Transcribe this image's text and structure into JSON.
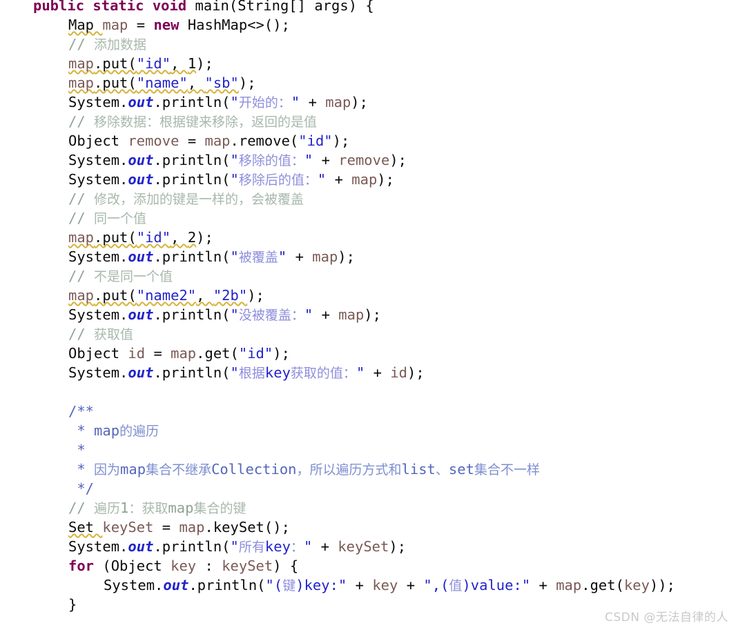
{
  "editor": {
    "language": "java",
    "colors": {
      "keyword": "#7f0055",
      "string": "#2222cc",
      "string_cjk": "#8e8ede",
      "comment": "#8fa396",
      "javadoc": "#5566bb",
      "local_variable": "#7a5a55",
      "static_field": "#2222cc",
      "plain": "#0b0b0b",
      "warning_underline": "#d6b33c",
      "background": "#ffffff"
    },
    "lines": [
      {
        "indent": 1,
        "segments": [
          {
            "t": "public ",
            "c": "kw"
          },
          {
            "t": "static ",
            "c": "kw"
          },
          {
            "t": "void ",
            "c": "kw"
          },
          {
            "t": "main(String[] args) {",
            "c": "plain"
          }
        ]
      },
      {
        "indent": 2,
        "segments": [
          {
            "t": "Map ",
            "c": "plain",
            "wavy": true
          },
          {
            "t": "map ",
            "c": "var"
          },
          {
            "t": "= ",
            "c": "plain"
          },
          {
            "t": "new ",
            "c": "kw"
          },
          {
            "t": "HashMap<>();",
            "c": "plain"
          }
        ]
      },
      {
        "indent": 2,
        "segments": [
          {
            "t": "// ",
            "c": "cmt"
          },
          {
            "t": "添加数据",
            "c": "cmt-cjk",
            "cjk": true
          }
        ]
      },
      {
        "indent": 2,
        "segments": [
          {
            "t": "map",
            "c": "var",
            "wavy": true
          },
          {
            "t": ".put(",
            "c": "plain",
            "wavy": true
          },
          {
            "t": "\"id\"",
            "c": "str",
            "wavy": true
          },
          {
            "t": ", ",
            "c": "plain",
            "wavy": true
          },
          {
            "t": "1",
            "c": "num",
            "wavy": true
          },
          {
            "t": ");",
            "c": "plain"
          }
        ]
      },
      {
        "indent": 2,
        "segments": [
          {
            "t": "map",
            "c": "var",
            "wavy": true
          },
          {
            "t": ".put(",
            "c": "plain",
            "wavy": true
          },
          {
            "t": "\"name\"",
            "c": "str",
            "wavy": true
          },
          {
            "t": ", ",
            "c": "plain",
            "wavy": true
          },
          {
            "t": "\"sb\"",
            "c": "str",
            "wavy": true
          },
          {
            "t": ");",
            "c": "plain"
          }
        ]
      },
      {
        "indent": 2,
        "segments": [
          {
            "t": "System.",
            "c": "plain"
          },
          {
            "t": "out",
            "c": "fld"
          },
          {
            "t": ".println(",
            "c": "plain"
          },
          {
            "t": "\"",
            "c": "str"
          },
          {
            "t": "开始的：",
            "c": "str-cjk",
            "cjk": true
          },
          {
            "t": "\" ",
            "c": "str"
          },
          {
            "t": "+ ",
            "c": "plain"
          },
          {
            "t": "map",
            "c": "var"
          },
          {
            "t": ");",
            "c": "plain"
          }
        ]
      },
      {
        "indent": 2,
        "segments": [
          {
            "t": "// ",
            "c": "cmt"
          },
          {
            "t": "移除数据：根据键来移除，返回的是值",
            "c": "cmt-cjk",
            "cjk": true
          }
        ]
      },
      {
        "indent": 2,
        "segments": [
          {
            "t": "Object ",
            "c": "plain"
          },
          {
            "t": "remove ",
            "c": "var"
          },
          {
            "t": "= ",
            "c": "plain"
          },
          {
            "t": "map",
            "c": "var"
          },
          {
            "t": ".remove(",
            "c": "plain"
          },
          {
            "t": "\"id\"",
            "c": "str"
          },
          {
            "t": ");",
            "c": "plain"
          }
        ]
      },
      {
        "indent": 2,
        "segments": [
          {
            "t": "System.",
            "c": "plain"
          },
          {
            "t": "out",
            "c": "fld"
          },
          {
            "t": ".println(",
            "c": "plain"
          },
          {
            "t": "\"",
            "c": "str"
          },
          {
            "t": "移除的值：",
            "c": "str-cjk",
            "cjk": true
          },
          {
            "t": "\" ",
            "c": "str"
          },
          {
            "t": "+ ",
            "c": "plain"
          },
          {
            "t": "remove",
            "c": "var"
          },
          {
            "t": ");",
            "c": "plain"
          }
        ]
      },
      {
        "indent": 2,
        "segments": [
          {
            "t": "System.",
            "c": "plain"
          },
          {
            "t": "out",
            "c": "fld"
          },
          {
            "t": ".println(",
            "c": "plain"
          },
          {
            "t": "\"",
            "c": "str"
          },
          {
            "t": "移除后的值：",
            "c": "str-cjk",
            "cjk": true
          },
          {
            "t": "\" ",
            "c": "str"
          },
          {
            "t": "+ ",
            "c": "plain"
          },
          {
            "t": "map",
            "c": "var"
          },
          {
            "t": ");",
            "c": "plain"
          }
        ]
      },
      {
        "indent": 2,
        "segments": [
          {
            "t": "// ",
            "c": "cmt"
          },
          {
            "t": "修改，添加的键是一样的，会被覆盖",
            "c": "cmt-cjk",
            "cjk": true
          }
        ]
      },
      {
        "indent": 2,
        "segments": [
          {
            "t": "// ",
            "c": "cmt"
          },
          {
            "t": "同一个值",
            "c": "cmt-cjk",
            "cjk": true
          }
        ]
      },
      {
        "indent": 2,
        "segments": [
          {
            "t": "map",
            "c": "var",
            "wavy": true
          },
          {
            "t": ".put(",
            "c": "plain",
            "wavy": true
          },
          {
            "t": "\"id\"",
            "c": "str",
            "wavy": true
          },
          {
            "t": ", ",
            "c": "plain",
            "wavy": true
          },
          {
            "t": "2",
            "c": "num",
            "wavy": true
          },
          {
            "t": ");",
            "c": "plain"
          }
        ]
      },
      {
        "indent": 2,
        "segments": [
          {
            "t": "System.",
            "c": "plain"
          },
          {
            "t": "out",
            "c": "fld"
          },
          {
            "t": ".println(",
            "c": "plain"
          },
          {
            "t": "\"",
            "c": "str"
          },
          {
            "t": "被覆盖",
            "c": "str-cjk",
            "cjk": true
          },
          {
            "t": "\" ",
            "c": "str"
          },
          {
            "t": "+ ",
            "c": "plain"
          },
          {
            "t": "map",
            "c": "var"
          },
          {
            "t": ");",
            "c": "plain"
          }
        ]
      },
      {
        "indent": 2,
        "segments": [
          {
            "t": "// ",
            "c": "cmt"
          },
          {
            "t": "不是同一个值",
            "c": "cmt-cjk",
            "cjk": true
          }
        ]
      },
      {
        "indent": 2,
        "segments": [
          {
            "t": "map",
            "c": "var",
            "wavy": true
          },
          {
            "t": ".put(",
            "c": "plain",
            "wavy": true
          },
          {
            "t": "\"name2\"",
            "c": "str",
            "wavy": true
          },
          {
            "t": ", ",
            "c": "plain",
            "wavy": true
          },
          {
            "t": "\"2b\"",
            "c": "str",
            "wavy": true
          },
          {
            "t": ");",
            "c": "plain"
          }
        ]
      },
      {
        "indent": 2,
        "segments": [
          {
            "t": "System.",
            "c": "plain"
          },
          {
            "t": "out",
            "c": "fld"
          },
          {
            "t": ".println(",
            "c": "plain"
          },
          {
            "t": "\"",
            "c": "str"
          },
          {
            "t": "没被覆盖：",
            "c": "str-cjk",
            "cjk": true
          },
          {
            "t": "\" ",
            "c": "str"
          },
          {
            "t": "+ ",
            "c": "plain"
          },
          {
            "t": "map",
            "c": "var"
          },
          {
            "t": ");",
            "c": "plain"
          }
        ]
      },
      {
        "indent": 2,
        "segments": [
          {
            "t": "// ",
            "c": "cmt"
          },
          {
            "t": "获取值",
            "c": "cmt-cjk",
            "cjk": true
          }
        ]
      },
      {
        "indent": 2,
        "segments": [
          {
            "t": "Object ",
            "c": "plain"
          },
          {
            "t": "id ",
            "c": "var"
          },
          {
            "t": "= ",
            "c": "plain"
          },
          {
            "t": "map",
            "c": "var"
          },
          {
            "t": ".get(",
            "c": "plain"
          },
          {
            "t": "\"id\"",
            "c": "str"
          },
          {
            "t": ");",
            "c": "plain"
          }
        ]
      },
      {
        "indent": 2,
        "segments": [
          {
            "t": "System.",
            "c": "plain"
          },
          {
            "t": "out",
            "c": "fld"
          },
          {
            "t": ".println(",
            "c": "plain"
          },
          {
            "t": "\"",
            "c": "str"
          },
          {
            "t": "根据",
            "c": "str-cjk",
            "cjk": true
          },
          {
            "t": "key",
            "c": "str"
          },
          {
            "t": "获取的值：",
            "c": "str-cjk",
            "cjk": true
          },
          {
            "t": "\" ",
            "c": "str"
          },
          {
            "t": "+ ",
            "c": "plain"
          },
          {
            "t": "id",
            "c": "var"
          },
          {
            "t": ");",
            "c": "plain"
          }
        ]
      },
      {
        "blank": true
      },
      {
        "indent": 2,
        "segments": [
          {
            "t": "/**",
            "c": "doc"
          }
        ]
      },
      {
        "indent": 2,
        "segments": [
          {
            "t": " * ",
            "c": "doc"
          },
          {
            "t": "map",
            "c": "doc"
          },
          {
            "t": "的遍历",
            "c": "doc-cjk",
            "cjk": true
          }
        ]
      },
      {
        "indent": 2,
        "segments": [
          {
            "t": " *",
            "c": "doc"
          }
        ]
      },
      {
        "indent": 2,
        "segments": [
          {
            "t": " * ",
            "c": "doc"
          },
          {
            "t": "因为",
            "c": "doc-cjk",
            "cjk": true
          },
          {
            "t": "map",
            "c": "doc"
          },
          {
            "t": "集合不继承",
            "c": "doc-cjk",
            "cjk": true
          },
          {
            "t": "Collection",
            "c": "doc"
          },
          {
            "t": "，所以遍历方式和",
            "c": "doc-cjk",
            "cjk": true
          },
          {
            "t": "list",
            "c": "doc"
          },
          {
            "t": "、",
            "c": "doc-cjk",
            "cjk": true
          },
          {
            "t": "set",
            "c": "doc"
          },
          {
            "t": "集合不一样",
            "c": "doc-cjk",
            "cjk": true
          }
        ]
      },
      {
        "indent": 2,
        "segments": [
          {
            "t": " */",
            "c": "doc"
          }
        ]
      },
      {
        "indent": 2,
        "segments": [
          {
            "t": "// ",
            "c": "cmt"
          },
          {
            "t": "遍历",
            "c": "cmt-cjk",
            "cjk": true
          },
          {
            "t": "1",
            "c": "cmt"
          },
          {
            "t": "：获取",
            "c": "cmt-cjk",
            "cjk": true
          },
          {
            "t": "map",
            "c": "cmt"
          },
          {
            "t": "集合的键",
            "c": "cmt-cjk",
            "cjk": true
          }
        ]
      },
      {
        "indent": 2,
        "segments": [
          {
            "t": "Set ",
            "c": "plain",
            "wavy": true
          },
          {
            "t": "keySet ",
            "c": "var"
          },
          {
            "t": "= ",
            "c": "plain"
          },
          {
            "t": "map",
            "c": "var"
          },
          {
            "t": ".keySet();",
            "c": "plain"
          }
        ]
      },
      {
        "indent": 2,
        "segments": [
          {
            "t": "System.",
            "c": "plain"
          },
          {
            "t": "out",
            "c": "fld"
          },
          {
            "t": ".println(",
            "c": "plain"
          },
          {
            "t": "\"",
            "c": "str"
          },
          {
            "t": "所有",
            "c": "str-cjk",
            "cjk": true
          },
          {
            "t": "key",
            "c": "str"
          },
          {
            "t": "：",
            "c": "str-cjk",
            "cjk": true
          },
          {
            "t": "\" ",
            "c": "str"
          },
          {
            "t": "+ ",
            "c": "plain"
          },
          {
            "t": "keySet",
            "c": "var"
          },
          {
            "t": ");",
            "c": "plain"
          }
        ]
      },
      {
        "indent": 2,
        "segments": [
          {
            "t": "for ",
            "c": "kw"
          },
          {
            "t": "(Object ",
            "c": "plain"
          },
          {
            "t": "key ",
            "c": "var"
          },
          {
            "t": ": ",
            "c": "plain"
          },
          {
            "t": "keySet",
            "c": "var"
          },
          {
            "t": ") {",
            "c": "plain"
          }
        ]
      },
      {
        "indent": 3,
        "segments": [
          {
            "t": "System.",
            "c": "plain"
          },
          {
            "t": "out",
            "c": "fld"
          },
          {
            "t": ".println(",
            "c": "plain"
          },
          {
            "t": "\"(",
            "c": "str"
          },
          {
            "t": "键",
            "c": "str-cjk",
            "cjk": true
          },
          {
            "t": ")key:\" ",
            "c": "str"
          },
          {
            "t": "+ ",
            "c": "plain"
          },
          {
            "t": "key ",
            "c": "var"
          },
          {
            "t": "+ ",
            "c": "plain"
          },
          {
            "t": "\",(",
            "c": "str"
          },
          {
            "t": "值",
            "c": "str-cjk",
            "cjk": true
          },
          {
            "t": ")value:\"",
            "c": "str"
          },
          {
            "t": " + ",
            "c": "plain"
          },
          {
            "t": "map",
            "c": "var"
          },
          {
            "t": ".get(",
            "c": "plain"
          },
          {
            "t": "key",
            "c": "var"
          },
          {
            "t": "));",
            "c": "plain"
          }
        ]
      },
      {
        "indent": 2,
        "segments": [
          {
            "t": "}",
            "c": "plain"
          }
        ]
      }
    ]
  },
  "watermark": {
    "text": "CSDN @无法自律的人"
  }
}
